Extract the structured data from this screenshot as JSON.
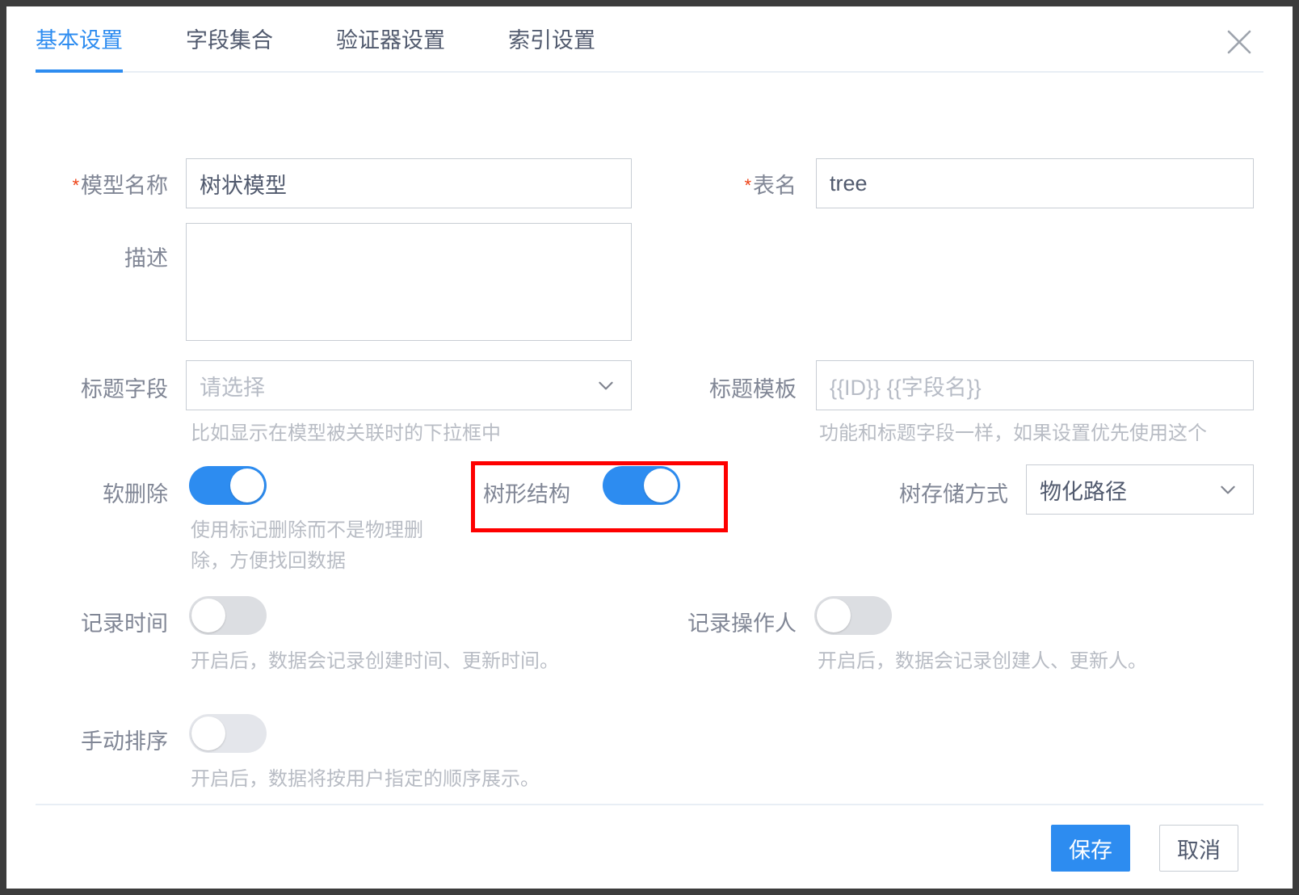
{
  "dialog": {
    "close_icon": "close-icon"
  },
  "tabs": [
    {
      "label": "基本设置",
      "active": true
    },
    {
      "label": "字段集合",
      "active": false
    },
    {
      "label": "验证器设置",
      "active": false
    },
    {
      "label": "索引设置",
      "active": false
    }
  ],
  "form": {
    "model_name": {
      "label": "模型名称",
      "required": true,
      "value": "树状模型"
    },
    "table_name": {
      "label": "表名",
      "required": true,
      "value": "tree"
    },
    "description": {
      "label": "描述",
      "value": ""
    },
    "title_field": {
      "label": "标题字段",
      "placeholder": "请选择",
      "value": "",
      "hint": "比如显示在模型被关联时的下拉框中"
    },
    "title_template": {
      "label": "标题模板",
      "placeholder": "{{ID}} {{字段名}}",
      "value": "",
      "hint": "功能和标题字段一样，如果设置优先使用这个"
    },
    "soft_delete": {
      "label": "软删除",
      "state": "on",
      "hint": "使用标记删除而不是物理删\n除，方便找回数据"
    },
    "tree_structure": {
      "label": "树形结构",
      "state": "on",
      "highlighted": true
    },
    "tree_storage": {
      "label": "树存储方式",
      "value": "物化路径"
    },
    "record_time": {
      "label": "记录时间",
      "state": "off",
      "hint": "开启后，数据会记录创建时间、更新时间。"
    },
    "record_operator": {
      "label": "记录操作人",
      "state": "off",
      "hint": "开启后，数据会记录创建人、更新人。"
    },
    "manual_sort": {
      "label": "手动排序",
      "state": "off",
      "hint": "开启后，数据将按用户指定的顺序展示。"
    }
  },
  "footer": {
    "save_label": "保存",
    "cancel_label": "取消"
  },
  "colors": {
    "accent": "#2d8cf0",
    "required_star": "#ed4014",
    "highlight": "#fe0000",
    "label_text": "#808695",
    "hint_text": "#b8bcc4",
    "border": "#c8cdd4"
  }
}
